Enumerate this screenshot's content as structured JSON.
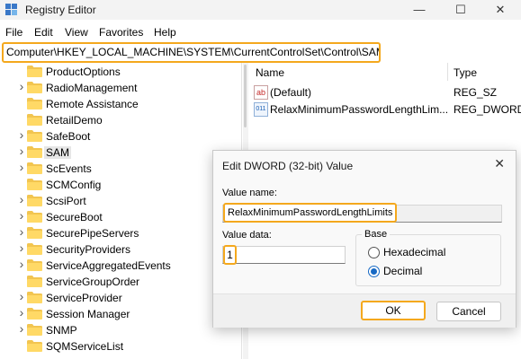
{
  "window": {
    "title": "Registry Editor",
    "minimize": "—",
    "maximize": "☐",
    "close": "✕"
  },
  "menu": [
    "File",
    "Edit",
    "View",
    "Favorites",
    "Help"
  ],
  "address": "Computer\\HKEY_LOCAL_MACHINE\\SYSTEM\\CurrentControlSet\\Control\\SAM",
  "tree": [
    {
      "label": "ProductOptions",
      "expandable": false,
      "selected": false
    },
    {
      "label": "RadioManagement",
      "expandable": true,
      "selected": false
    },
    {
      "label": "Remote Assistance",
      "expandable": false,
      "selected": false
    },
    {
      "label": "RetailDemo",
      "expandable": false,
      "selected": false
    },
    {
      "label": "SafeBoot",
      "expandable": true,
      "selected": false
    },
    {
      "label": "SAM",
      "expandable": true,
      "selected": true
    },
    {
      "label": "ScEvents",
      "expandable": true,
      "selected": false
    },
    {
      "label": "SCMConfig",
      "expandable": false,
      "selected": false
    },
    {
      "label": "ScsiPort",
      "expandable": true,
      "selected": false
    },
    {
      "label": "SecureBoot",
      "expandable": true,
      "selected": false
    },
    {
      "label": "SecurePipeServers",
      "expandable": true,
      "selected": false
    },
    {
      "label": "SecurityProviders",
      "expandable": true,
      "selected": false
    },
    {
      "label": "ServiceAggregatedEvents",
      "expandable": true,
      "selected": false
    },
    {
      "label": "ServiceGroupOrder",
      "expandable": false,
      "selected": false
    },
    {
      "label": "ServiceProvider",
      "expandable": true,
      "selected": false
    },
    {
      "label": "Session Manager",
      "expandable": true,
      "selected": false
    },
    {
      "label": "SNMP",
      "expandable": true,
      "selected": false
    },
    {
      "label": "SQMServiceList",
      "expandable": false,
      "selected": false
    }
  ],
  "columns": {
    "name": "Name",
    "type": "Type"
  },
  "values": [
    {
      "name": "(Default)",
      "type": "REG_SZ",
      "icon": "ab"
    },
    {
      "name": "RelaxMinimumPasswordLengthLim...",
      "type": "REG_DWORD",
      "icon": "011"
    }
  ],
  "dialog": {
    "title": "Edit DWORD (32-bit) Value",
    "close": "✕",
    "value_name_label": "Value name:",
    "value_name": "RelaxMinimumPasswordLengthLimits",
    "value_data_label": "Value data:",
    "value_data": "1",
    "base_label": "Base",
    "hex_label": "Hexadecimal",
    "dec_label": "Decimal",
    "ok": "OK",
    "cancel": "Cancel"
  },
  "colors": {
    "highlight": "#f4a81d",
    "folder": "#f2c550",
    "radio_accent": "#1769c4"
  }
}
